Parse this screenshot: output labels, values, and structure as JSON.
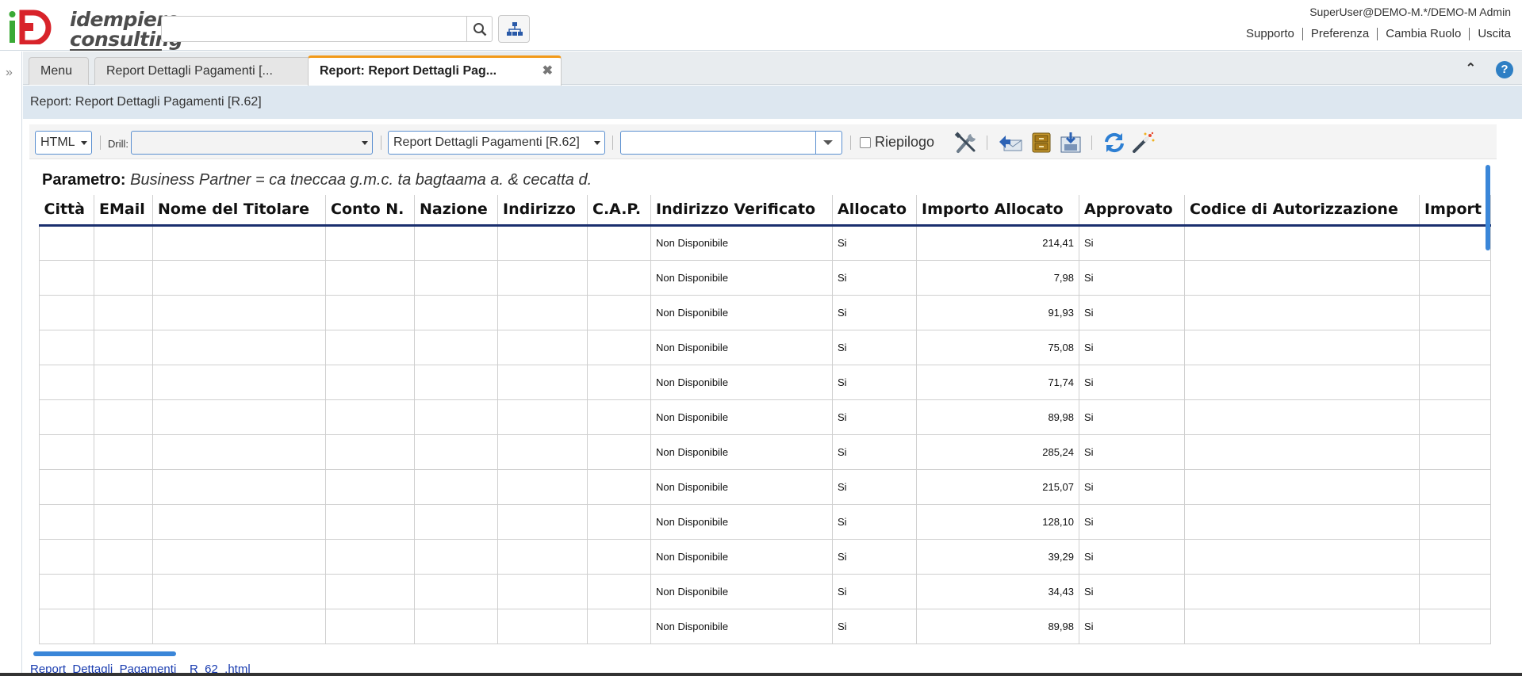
{
  "header": {
    "logo_line1": "idempiere",
    "logo_line2": "consulting",
    "search_placeholder": "",
    "user": "SuperUser@DEMO-M.*/DEMO-M Admin",
    "links": [
      "Supporto",
      "Preferenza",
      "Cambia Ruolo",
      "Uscita"
    ]
  },
  "tabs": {
    "menu": "Menu",
    "report1": "Report Dettagli Pagamenti [...",
    "report2": "Report: Report Dettagli Pag..."
  },
  "window_title": "Report: Report Dettagli Pagamenti [R.62]",
  "toolbar": {
    "format_value": "HTML",
    "drill_label": "Drill:",
    "drill_value": "",
    "report_value": "Report Dettagli Pagamenti [R.62]",
    "extra_value": "",
    "summary_label": "Riepilogo"
  },
  "report": {
    "param_label": "Parametro:",
    "param_value": "Business Partner = ca tneccaa g.m.c. ta bagtaama a. & cecatta d.",
    "columns": [
      "Città",
      "EMail",
      "Nome del Titolare",
      "Conto N.",
      "Nazione",
      "Indirizzo",
      "C.A.P.",
      "Indirizzo Verificato",
      "Allocato",
      "Importo Allocato",
      "Approvato",
      "Codice di Autorizzazione",
      "Import"
    ],
    "rows": [
      {
        "verificato": "Non Disponibile",
        "allocato": "Si",
        "importo": "214,41",
        "approvato": "Si"
      },
      {
        "verificato": "Non Disponibile",
        "allocato": "Si",
        "importo": "7,98",
        "approvato": "Si"
      },
      {
        "verificato": "Non Disponibile",
        "allocato": "Si",
        "importo": "91,93",
        "approvato": "Si"
      },
      {
        "verificato": "Non Disponibile",
        "allocato": "Si",
        "importo": "75,08",
        "approvato": "Si"
      },
      {
        "verificato": "Non Disponibile",
        "allocato": "Si",
        "importo": "71,74",
        "approvato": "Si"
      },
      {
        "verificato": "Non Disponibile",
        "allocato": "Si",
        "importo": "89,98",
        "approvato": "Si"
      },
      {
        "verificato": "Non Disponibile",
        "allocato": "Si",
        "importo": "285,24",
        "approvato": "Si"
      },
      {
        "verificato": "Non Disponibile",
        "allocato": "Si",
        "importo": "215,07",
        "approvato": "Si"
      },
      {
        "verificato": "Non Disponibile",
        "allocato": "Si",
        "importo": "128,10",
        "approvato": "Si"
      },
      {
        "verificato": "Non Disponibile",
        "allocato": "Si",
        "importo": "39,29",
        "approvato": "Si"
      },
      {
        "verificato": "Non Disponibile",
        "allocato": "Si",
        "importo": "34,43",
        "approvato": "Si"
      },
      {
        "verificato": "Non Disponibile",
        "allocato": "Si",
        "importo": "89,98",
        "approvato": "Si"
      }
    ]
  },
  "download_link": "Report_Dettagli_Pagamenti__R_62_.html",
  "colors": {
    "accent_tab": "#f29a1a",
    "title_strip": "#dde7f0",
    "header_underline": "#1a2f6e",
    "scrollbar": "#3a86d8",
    "logo_red": "#d8232a",
    "logo_green": "#3aa935"
  }
}
